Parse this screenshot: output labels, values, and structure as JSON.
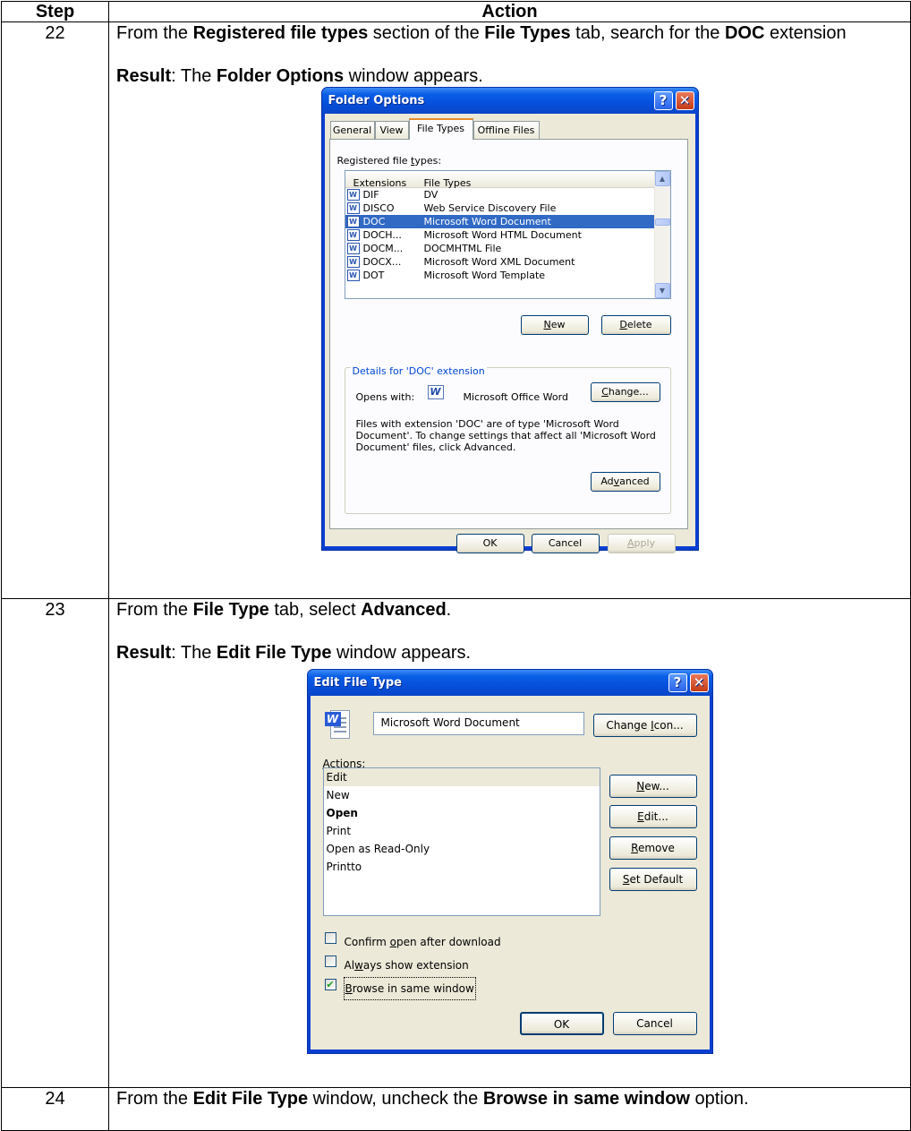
{
  "table": {
    "header_step": "Step",
    "header_action": "Action",
    "rows": [
      {
        "step": "22",
        "text": [
          {
            "t": "From the "
          },
          {
            "b": "Registered file types"
          },
          {
            "t": " section of the "
          },
          {
            "b": "File Types"
          },
          {
            "t": " tab, search for the "
          },
          {
            "b": "DOC"
          },
          {
            "t": " extension"
          }
        ],
        "result": [
          {
            "b": "Result"
          },
          {
            "t": ":  The "
          },
          {
            "b": "Folder Options"
          },
          {
            "t": " window appears."
          }
        ]
      },
      {
        "step": "23",
        "text": [
          {
            "t": "From the "
          },
          {
            "b": "File Type"
          },
          {
            "t": " tab, select "
          },
          {
            "b": "Advanced"
          },
          {
            "t": "."
          }
        ],
        "result": [
          {
            "b": "Result"
          },
          {
            "t": ":  The "
          },
          {
            "b": "Edit File Type"
          },
          {
            "t": " window appears."
          }
        ]
      },
      {
        "step": "24",
        "text": [
          {
            "t": "From the "
          },
          {
            "b": "Edit File Type"
          },
          {
            "t": " window, uncheck the "
          },
          {
            "b": "Browse in same window"
          },
          {
            "t": " option."
          }
        ]
      }
    ]
  },
  "folder_options": {
    "title": "Folder Options",
    "tabs": [
      "General",
      "View",
      "File Types",
      "Offline Files"
    ],
    "active_tab": "File Types",
    "registered_label": "Registered file types:",
    "col_extensions": "Extensions",
    "col_file_types": "File Types",
    "rows": [
      {
        "ext": "DIF",
        "type": "DV",
        "selected": false
      },
      {
        "ext": "DISCO",
        "type": "Web Service Discovery File",
        "selected": false
      },
      {
        "ext": "DOC",
        "type": "Microsoft Word Document",
        "selected": true
      },
      {
        "ext": "DOCH...",
        "type": "Microsoft Word HTML Document",
        "selected": false
      },
      {
        "ext": "DOCM...",
        "type": "DOCMHTML File",
        "selected": false
      },
      {
        "ext": "DOCX...",
        "type": "Microsoft Word XML Document",
        "selected": false
      },
      {
        "ext": "DOT",
        "type": "Microsoft Word Template",
        "selected": false
      }
    ],
    "new_label": "New",
    "delete_label": "Delete",
    "details_legend": "Details for 'DOC' extension",
    "opens_with_label": "Opens with:",
    "opens_with_app": "Microsoft Office Word",
    "change_label": "Change...",
    "description": "Files with extension 'DOC' are of type 'Microsoft Word Document'. To change settings that affect all 'Microsoft Word Document' files, click Advanced.",
    "advanced_label": "Advanced",
    "ok_label": "OK",
    "cancel_label": "Cancel",
    "apply_label": "Apply"
  },
  "edit_file_type": {
    "title": "Edit File Type",
    "name_value": "Microsoft Word Document",
    "change_icon_label": "Change Icon...",
    "actions_label": "Actions:",
    "actions": [
      {
        "label": "Edit",
        "bold": false,
        "selected": true
      },
      {
        "label": "New",
        "bold": false,
        "selected": false
      },
      {
        "label": "Open",
        "bold": true,
        "selected": false
      },
      {
        "label": "Print",
        "bold": false,
        "selected": false
      },
      {
        "label": "Open as Read-Only",
        "bold": false,
        "selected": false
      },
      {
        "label": "Printto",
        "bold": false,
        "selected": false
      }
    ],
    "new_label": "New...",
    "edit_label": "Edit...",
    "remove_label": "Remove",
    "set_default_label": "Set Default",
    "confirm_open_label": "Confirm open after download",
    "confirm_open_checked": false,
    "always_show_label": "Always show extension",
    "always_show_checked": false,
    "browse_same_label": "Browse in same window",
    "browse_same_checked": true,
    "ok_label": "OK",
    "cancel_label": "Cancel"
  }
}
